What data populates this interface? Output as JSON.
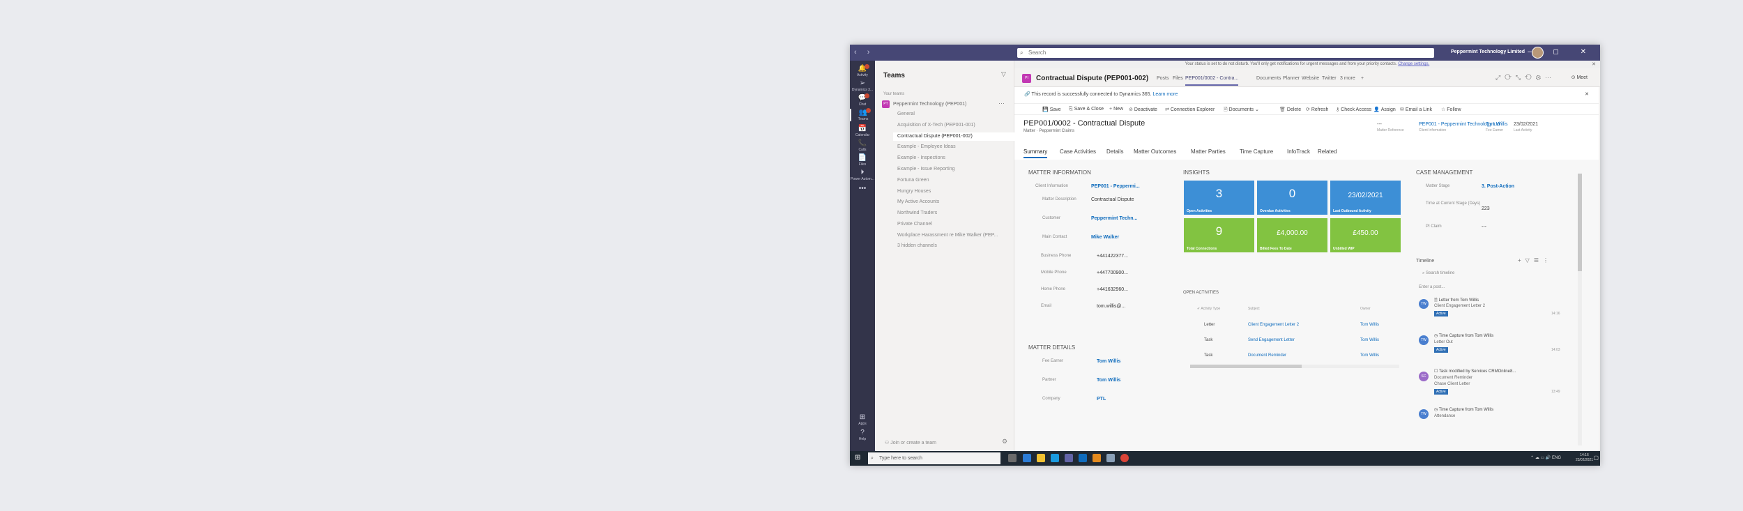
{
  "window": {
    "search_placeholder": "Search",
    "org_name": "Peppermint Technology Limited",
    "nav_arrows": "‹ ›",
    "controls": "⋯ – ◻ ✕"
  },
  "notice": {
    "text": "Your status is set to do not disturb. You'll only get notifications for urgent messages and from your priority contacts.",
    "link": "Change settings."
  },
  "rail": [
    {
      "label": "Activity",
      "glyph": "🔔"
    },
    {
      "label": "Dynamics 3...",
      "glyph": "➢"
    },
    {
      "label": "Chat",
      "glyph": "💬"
    },
    {
      "label": "Teams",
      "glyph": "👥"
    },
    {
      "label": "Calendar",
      "glyph": "📅"
    },
    {
      "label": "Calls",
      "glyph": "📞"
    },
    {
      "label": "Files",
      "glyph": "📄"
    },
    {
      "label": "Power Autom...",
      "glyph": "⏵"
    },
    {
      "label": "",
      "glyph": "•••"
    },
    {
      "label": "Apps",
      "glyph": "⊞"
    },
    {
      "label": "Help",
      "glyph": "?"
    }
  ],
  "teams_panel": {
    "title": "Teams",
    "your_teams": "Your teams",
    "team_name": "Peppermint Technology (PEP001)",
    "team_initials": "PT",
    "channels": [
      "General",
      "Acquisition of X-Tech (PEP001-001)",
      "Contractual Dispute (PEP001-002)",
      "Example - Employee Ideas",
      "Example - Inspections",
      "Example - Issue Reporting",
      "Fortuna Green",
      "Hungry Houses",
      "My Active Accounts",
      "Northwind Traders",
      "Private Channel",
      "Workplace Harassment re Mike Walker (PEP...",
      "3 hidden channels"
    ],
    "join": "Join or create a team"
  },
  "channel_header": {
    "initials": "PI",
    "title": "Contractual Dispute (PEP001-002)",
    "tabs": [
      "Posts",
      "Files",
      "PEP001/0002 - Contra...",
      "Documents",
      "Planner",
      "Website",
      "Twitter",
      "3 more",
      "+"
    ],
    "meet": "Meet"
  },
  "crm": {
    "connected_text": "This record is successfully connected to Dynamics 365.",
    "learn_more": "Learn more",
    "commands": [
      "Save",
      "Save & Close",
      "New",
      "Deactivate",
      "Connection Explorer",
      "Documents",
      "Delete",
      "Refresh",
      "Check Access",
      "Assign",
      "Email a Link",
      "Follow"
    ],
    "record_title": "PEP001/0002 - Contractual Dispute",
    "record_sub": "Matter · Peppermint Claims",
    "header_fields": [
      {
        "value": "---",
        "label": "Matter Reference"
      },
      {
        "value": "PEP001 - Peppermint Technology Ltd",
        "label": "Client Information"
      },
      {
        "value": "Tom Willis",
        "label": "Fee Earner"
      },
      {
        "value": "23/02/2021",
        "label": "Last Activity"
      }
    ],
    "tabs": [
      "Summary",
      "Case Activities",
      "Details",
      "Matter Outcomes",
      "Matter Parties",
      "Time Capture",
      "InfoTrack",
      "Related"
    ],
    "matter_info": {
      "title": "MATTER INFORMATION",
      "fields": [
        {
          "label": "Client Information",
          "value": "PEP001 - Peppermi..."
        },
        {
          "label": "Matter Description",
          "value": "Contractual Dispute"
        },
        {
          "label": "Customer",
          "value": "Peppermint Techn..."
        },
        {
          "label": "Main Contact",
          "value": "Mike Walker"
        },
        {
          "label": "Business Phone",
          "value": "+441422377..."
        },
        {
          "label": "Mobile Phone",
          "value": "+447700900..."
        },
        {
          "label": "Home Phone",
          "value": "+441632960..."
        },
        {
          "label": "Email",
          "value": "tom.willis@..."
        }
      ]
    },
    "matter_details": {
      "title": "MATTER DETAILS",
      "fields": [
        {
          "label": "Fee Earner",
          "value": "Tom Willis"
        },
        {
          "label": "Partner",
          "value": "Tom Willis"
        },
        {
          "label": "Company",
          "value": "PTL"
        }
      ]
    },
    "insights": {
      "title": "INSIGHTS",
      "tiles": [
        {
          "value": "3",
          "label": "Open Activities"
        },
        {
          "value": "0",
          "label": "Overdue Activities"
        },
        {
          "value": "23/02/2021",
          "label": "Last Outbound Activity"
        },
        {
          "value": "9",
          "label": "Total Connections"
        },
        {
          "value": "£4,000.00",
          "label": "Billed Fees To Date"
        },
        {
          "value": "£450.00",
          "label": "Unbilled WIP"
        }
      ]
    },
    "open_activities": {
      "title": "OPEN ACTIVITIES",
      "headers": [
        "Activity Type",
        "Subject",
        "Owner"
      ],
      "rows": [
        [
          "Letter",
          "Client Engagement Letter 2",
          "Tom Willis"
        ],
        [
          "Task",
          "Send Engagement Letter",
          "Tom Willis"
        ],
        [
          "Task",
          "Document Reminder",
          "Tom Willis"
        ]
      ]
    },
    "case_mgmt": {
      "title": "CASE MANAGEMENT",
      "fields": [
        {
          "label": "Matter Stage",
          "value": "3. Post-Action"
        },
        {
          "label": "Time at Current Stage (Days)",
          "value": "223"
        },
        {
          "label": "PI Claim",
          "value": "---"
        }
      ]
    },
    "timeline": {
      "title": "Timeline",
      "search": "Search timeline",
      "post": "Enter a post...",
      "items": [
        {
          "initials": "TW",
          "title": "Letter from Tom Willis",
          "sub": "Client Engagement Letter 2",
          "badge": "Active",
          "date": "14:16"
        },
        {
          "initials": "TW",
          "title": "Time Capture from Tom Willis",
          "sub": "Letter Out",
          "badge": "Active",
          "date": "14:03"
        },
        {
          "initials": "SC",
          "title": "Task modified by Services CRMOnline8...",
          "sub": "Document Reminder",
          "sub2": "Chase Client Letter",
          "badge": "Active",
          "date": "13:49"
        },
        {
          "initials": "TW",
          "title": "Time Capture from Tom Willis",
          "sub": "Attendance",
          "badge": "",
          "date": ""
        }
      ]
    }
  },
  "taskbar": {
    "search": "Type here to search",
    "lang": "ENG",
    "time": "14:16",
    "date": "23/02/2021"
  }
}
